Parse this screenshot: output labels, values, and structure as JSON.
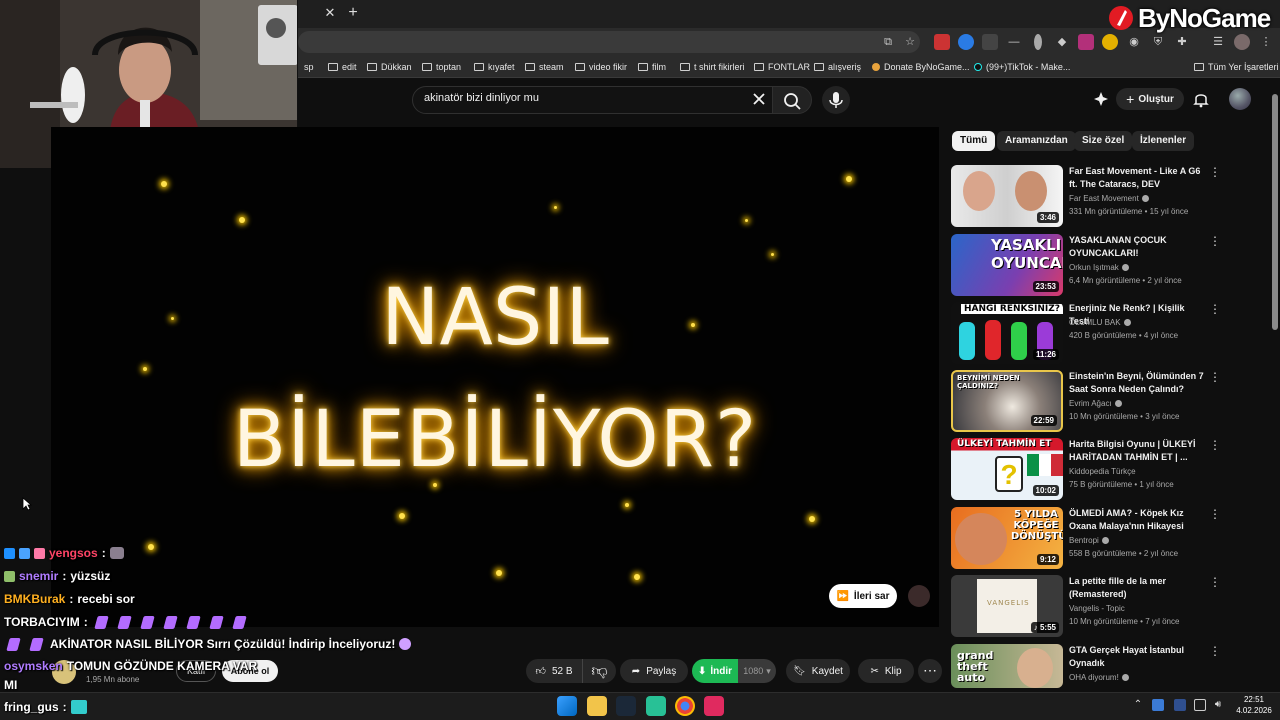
{
  "browser": {
    "bookmarks": [
      "sp",
      "edit",
      "Dükkan",
      "toptan",
      "kıyafet",
      "steam",
      "video fikir",
      "film",
      "t shirt fikirleri",
      "FONTLAR",
      "alışveriş",
      "Donate ByNoGame...",
      "(99+)TikTok - Make...",
      "Tüm Yer İşaretleri"
    ]
  },
  "brand": {
    "name": "ByNoGame"
  },
  "youtube": {
    "search_query": "akinatör bizi dinliyor mu",
    "create_label": "Oluştur",
    "player": {
      "overlay_line1": "NASIL",
      "overlay_line2": "BİLEBİLİYOR?",
      "skip_label": "İleri sar"
    },
    "channel": {
      "subscribers": "1,95 Mn abone",
      "join_label": "Katıl",
      "subscribe_label": "Abone ol"
    },
    "actions": {
      "likes": "52 B",
      "share": "Paylaş",
      "download": "İndir",
      "quality": "1080",
      "save": "Kaydet",
      "clip": "Klip"
    },
    "chips": [
      "Tümü",
      "Aramanızdan",
      "Size özel",
      "İzlenenler"
    ],
    "recommendations": [
      {
        "title": "Far East Movement - Like A G6 ft. The Cataracs, DEV",
        "channel": "Far East Movement",
        "views": "331 Mn görüntüleme",
        "age": "15 yıl önce",
        "duration": "3:46"
      },
      {
        "title": "YASAKLANAN ÇOCUK OYUNCAKLARI!",
        "channel": "Orkun Işıtmak",
        "views": "6,4 Mn görüntüleme",
        "age": "2 yıl önce",
        "duration": "23:53",
        "thumb_text": "YASAKLI OYUNCAKLAR"
      },
      {
        "title": "Enerjiniz Ne Renk? | Kişilik Testi",
        "channel": "OLUMLU BAK",
        "views": "420 B görüntüleme",
        "age": "4 yıl önce",
        "duration": "11:26",
        "thumb_text": "HANGİ RENKSİNİZ?"
      },
      {
        "title": "Einstein'ın Beyni, Ölümünden 7 Saat Sonra Neden Çalındı?",
        "channel": "Evrim Ağacı",
        "views": "10 Mn görüntüleme",
        "age": "3 yıl önce",
        "duration": "22:59",
        "thumb_text": "BEYNİMİ NEDEN ÇALDINIZ?"
      },
      {
        "title": "Harita Bilgisi Oyunu | ÜLKEYİ HARİTADAN TAHMİN ET | ...",
        "channel": "Kiddopedia Türkçe",
        "views": "75 B görüntüleme",
        "age": "1 yıl önce",
        "duration": "10:02",
        "thumb_text": "ÜLKEYİ TAHMİN ET"
      },
      {
        "title": "ÖLMEDİ AMA? - Köpek Kız Oxana Malaya'nın Hikayesi",
        "channel": "Bentropi",
        "views": "558 B görüntüleme",
        "age": "2 yıl önce",
        "duration": "9:12",
        "thumb_text": "5 YILDA KÖPEĞE DÖNÜŞTÜ"
      },
      {
        "title": "La petite fille de la mer (Remastered)",
        "channel": "Vangelis - Topic",
        "views": "10 Mn görüntüleme",
        "age": "7 yıl önce",
        "duration": "5:55",
        "thumb_text": "VANGELIS"
      },
      {
        "title": "GTA Gerçek Hayat İstanbul Oynadık",
        "channel": "OHA diyorum!",
        "views": "",
        "age": "",
        "duration": "",
        "thumb_text": "grand theft auto"
      }
    ]
  },
  "chat": [
    {
      "user": "yengsos",
      "text": "",
      "color": "#ff4466"
    },
    {
      "user": "snemir",
      "text": "yüzsüz",
      "color": "#b07cff"
    },
    {
      "user": "BMKBurak",
      "text": "recebi sor",
      "color": "#ffb020"
    },
    {
      "user": "TORBACIYIM",
      "text": "",
      "color": "#ffffff"
    },
    {
      "user": "",
      "text": "AKİNATOR NASIL BİLİYOR Sırrı Çözüldü! İndirip İnceliyoruz!",
      "color": "#ffffff"
    },
    {
      "user": "osymsken",
      "text": "TOMUN GÖZÜNDE KAMERA VAR",
      "color": "#b07cff"
    },
    {
      "user": "",
      "text": "MI",
      "color": "#ffffff"
    },
    {
      "user": "fring_gus",
      "text": "",
      "color": "#ffffff"
    }
  ],
  "taskbar": {
    "time": "22:51",
    "date": "4.02.2026"
  }
}
